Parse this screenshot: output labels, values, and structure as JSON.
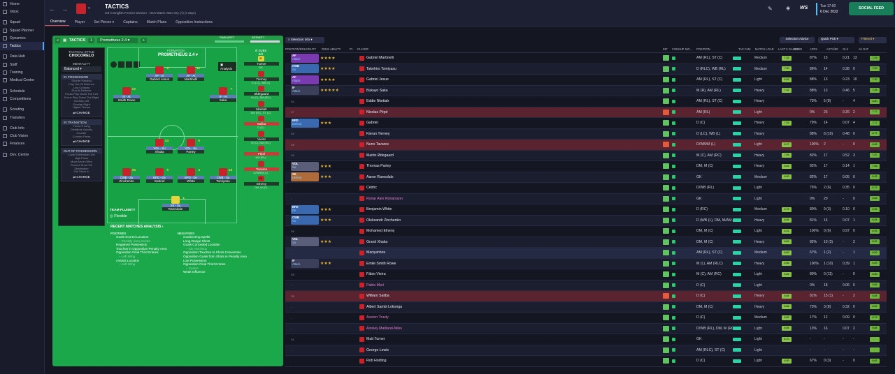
{
  "sidebar": {
    "items": [
      {
        "label": "Home",
        "icon": "home-icon"
      },
      {
        "label": "Inbox",
        "icon": "inbox-icon"
      },
      {
        "label": "Squad",
        "icon": "squad-icon"
      },
      {
        "label": "Squad Planner",
        "icon": "planner-icon"
      },
      {
        "label": "Dynamics",
        "icon": "dynamics-icon"
      },
      {
        "label": "Tactics",
        "icon": "tactics-icon"
      },
      {
        "label": "Data Hub",
        "icon": "data-hub-icon"
      },
      {
        "label": "Staff",
        "icon": "staff-icon"
      },
      {
        "label": "Training",
        "icon": "training-icon"
      },
      {
        "label": "Medical Centre",
        "icon": "medical-icon"
      },
      {
        "label": "Schedule",
        "icon": "schedule-icon"
      },
      {
        "label": "Competitions",
        "icon": "competitions-icon"
      },
      {
        "label": "Scouting",
        "icon": "scouting-icon"
      },
      {
        "label": "Transfers",
        "icon": "transfers-icon"
      },
      {
        "label": "Club Info",
        "icon": "club-info-icon"
      },
      {
        "label": "Club Vision",
        "icon": "club-vision-icon"
      },
      {
        "label": "Finances",
        "icon": "finances-icon"
      },
      {
        "label": "Dev. Centre",
        "icon": "dev-centre-icon"
      }
    ]
  },
  "header": {
    "title": "TACTICS",
    "subtitle": "3rd in English Premier Division - Next Match: Man City (A) (4 days)",
    "date_day": "Tue 17:00",
    "date": "6 Dec 2022",
    "social_feed": "SOCIAL FEED",
    "tabs": [
      "Overview",
      "Player",
      "Set Pieces ▾",
      "Captains",
      "Match Plans",
      "Opposition Instructions"
    ]
  },
  "tactics_bar": {
    "label": "TACTICS",
    "number": "1",
    "name": "Prometheus 2.4",
    "familiarity": "FAMILIARITY",
    "intensity": "INTENSITY"
  },
  "style": {
    "title": "TACTICAL STYLE",
    "name": "CHOCORELO",
    "mentality_label": "MENTALITY",
    "mentality": "Balanced",
    "in_possession": "IN POSSESSION",
    "in_possession_lines": [
      "Shorter Passing",
      "Play Out Of Defence",
      "Low Crosses",
      "Run At Defence",
      "Focus Play Down The Left",
      "Focus Play Down The Right",
      "Overlap Left",
      "Overlap Right",
      "Higher Tempo"
    ],
    "in_transition": "IN TRANSITION",
    "in_transition_lines": [
      "Throw It Long",
      "Distribute Quickly",
      "Counter",
      "Counter-Press"
    ],
    "out_of_possession": "OUT OF POSSESSION",
    "out_of_possession_lines": [
      "Lower Defensive Line",
      "High Press",
      "Much More Often",
      "Prevent Short GK",
      "Distribution",
      "Get Stuck In"
    ],
    "change": "CHANGE"
  },
  "formation": {
    "label": "FORMATION",
    "name": "PROMETHEUS 2.4",
    "analysis": "Analysis",
    "team_fluidity_label": "TEAM FLUIDITY",
    "team_fluidity": "Flexible"
  },
  "pitch_players": [
    {
      "num": "9",
      "role": "AF - At",
      "name": "Gabriel Jesus"
    },
    {
      "num": "11",
      "role": "AF - At",
      "name": "Martinelli"
    },
    {
      "num": "10",
      "role": "IF - At",
      "name": "Smith Rowe"
    },
    {
      "num": "7",
      "role": "IF - At",
      "name": "Saka"
    },
    {
      "num": "34",
      "role": "VOL - Su",
      "name": "Xhaka"
    },
    {
      "num": "5",
      "role": "VOL - Su",
      "name": "Partey"
    },
    {
      "num": "35",
      "role": "CWB - Su",
      "name": "Zinchenko"
    },
    {
      "num": "6",
      "role": "BPD - De",
      "name": "Gabriel"
    },
    {
      "num": "4",
      "role": "BPD - De",
      "name": "White"
    },
    {
      "num": "18",
      "role": "CWB - Su",
      "name": "Tomiyasu"
    },
    {
      "num": "1",
      "role": "SK - Su",
      "name": "Ramsdale"
    }
  ],
  "subs": {
    "header": "SUBS",
    "count": "9/9",
    "items": [
      {
        "num": "31",
        "name": "Turner",
        "pos": "GK"
      },
      {
        "num": "",
        "name": "Tierney",
        "pos": "D (LC), WB (L)"
      },
      {
        "num": "",
        "name": "Ødegaard",
        "pos": "M (C), AM (RC)"
      },
      {
        "num": "",
        "name": "Nketiah",
        "pos": "AM (RL), ST (C)"
      },
      {
        "num": "",
        "name": "Saliba",
        "pos": "D (C)"
      },
      {
        "num": "",
        "name": "Vieira",
        "pos": "M (C), AM (RC)"
      },
      {
        "num": "",
        "name": "Pépé",
        "pos": "AM (RL)"
      },
      {
        "num": "",
        "name": "Tavares",
        "pos": "D/WB/M (L)"
      },
      {
        "num": "23",
        "name": "Elneny",
        "pos": "DM, M (C)"
      }
    ]
  },
  "analysis": {
    "title": "RECENT MATCHES ANALYSIS",
    "positives_label": "POSITIVES",
    "positives": [
      "Goals Scored Location",
      "– Penalty Area Centre",
      "Regained Possession",
      "Touches in Opposition Penalty Area",
      "Opposition Final Third Entries",
      "– Left Wing",
      "Assists Location",
      "– Left Wing"
    ],
    "negatives_label": "NEGATIVES",
    "negatives": [
      "Goalscoring Spells",
      "Long-Range Shots",
      "Goals Conceded Location",
      "– Six Yard Box",
      "Opposition Touches to Shots Conversion",
      "Opposition Goals from Shots in Penalty Area",
      "Lost Possession",
      "Opposition Final Third Entries",
      "– Centre",
      "Weak Influence"
    ]
  },
  "table": {
    "selection_info": "Selection Info",
    "toolbar": [
      "Selection Advice",
      "Quick Pick",
      "Filtered"
    ],
    "columns": [
      "POSITION/ROLE/DUTY",
      "ROLE ABILITY",
      "PI",
      "PLAYER",
      "INF",
      "CON",
      "SHP",
      "MO...",
      "POSITION",
      "TAC FAM",
      "MATCH LOAD",
      "LAST 5 GAMES",
      "GWIN",
      "APPS",
      "ASTS/90",
      "GLS",
      "AV RAT"
    ],
    "rows": [
      {
        "pos": "STCR",
        "role": "AF",
        "duty": "Attack",
        "stars": "★★★★",
        "name": "Gabriel Martinelli",
        "position": "AM (RL), ST (C)",
        "load": "Medium",
        "rating": "7.25",
        "gwin": "87%",
        "apps": "15",
        "ast": "0.21",
        "gls": "13",
        "av": "7.29"
      },
      {
        "pos": "DR",
        "role": "CWB",
        "duty": "Su",
        "stars": "★★★★",
        "name": "Takehiro Tomiyasu",
        "position": "D (RLC), WB (RL)",
        "load": "Medium",
        "rating": "7.00",
        "gwin": "86%",
        "apps": "14",
        "ast": "0.38",
        "gls": "0",
        "av": "7.00"
      },
      {
        "pos": "STCL",
        "role": "AF",
        "duty": "Attack",
        "stars": "★★★★",
        "name": "Gabriel Jesus",
        "position": "AM (RL), ST (C)",
        "load": "Light",
        "rating": "6.83",
        "gwin": "88%",
        "apps": "13",
        "ast": "0.23",
        "gls": "10",
        "av": "7.30"
      },
      {
        "pos": "AMR",
        "role": "IF",
        "duty": "Attack",
        "stars": "★★★★★",
        "name": "Bukayo Saka",
        "position": "M (R), AM (RL)",
        "load": "Heavy",
        "rating": "7.12",
        "gwin": "88%",
        "apps": "13",
        "ast": "0.46",
        "gls": "5",
        "av": "7.26"
      },
      {
        "pos": "S4",
        "role": "",
        "duty": "",
        "stars": "",
        "name": "Eddie Nketiah",
        "position": "AM (RL), ST (C)",
        "load": "Heavy",
        "rating": "",
        "gwin": "73%",
        "apps": "5 (8)",
        "ast": "-",
        "gls": "4",
        "av": "6.80"
      },
      {
        "pos": "S7",
        "role": "",
        "duty": "",
        "stars": "",
        "name": "Nicolas Pépé",
        "position": "AM (RL)",
        "load": "Light",
        "rating": "",
        "gwin": "0%",
        "apps": "23",
        "ast": "0.26",
        "gls": "2",
        "av": "7.17",
        "red": true
      },
      {
        "pos": "DCL",
        "role": "BPD",
        "duty": "Defend",
        "stars": "★★★",
        "name": "Gabriel",
        "position": "D (C)",
        "load": "Heavy",
        "rating": "7.03",
        "gwin": "79%",
        "apps": "14",
        "ast": "0.07",
        "gls": "4",
        "av": "7.17"
      },
      {
        "pos": "S2",
        "role": "",
        "duty": "",
        "stars": "",
        "name": "Kieran Tierney",
        "position": "D (LC), WB (L)",
        "load": "Heavy",
        "rating": "",
        "gwin": "88%",
        "apps": "6 (10)",
        "ast": "0.48",
        "gls": "0",
        "av": "6.77"
      },
      {
        "pos": "S8",
        "role": "",
        "duty": "",
        "stars": "",
        "name": "Nuno Tavares",
        "position": "D/WB/M (L)",
        "load": "Light",
        "rating": "6.37",
        "gwin": "100%",
        "apps": "2",
        "ast": "-",
        "gls": "0",
        "av": "6.85",
        "red": true
      },
      {
        "pos": "S3",
        "role": "",
        "duty": "",
        "stars": "",
        "name": "Martin Ødegaard",
        "position": "M (C), AM (RC)",
        "load": "Heavy",
        "rating": "7.05",
        "gwin": "82%",
        "apps": "17",
        "ast": "0.52",
        "gls": "3",
        "av": "7.07"
      },
      {
        "pos": "DMCR",
        "role": "VOL",
        "duty": "Su",
        "stars": "★★★",
        "name": "Thomas Partey",
        "position": "DM, M (C)",
        "load": "Heavy",
        "rating": "6.83",
        "gwin": "82%",
        "apps": "17",
        "ast": "0.14",
        "gls": "1",
        "av": "7.06"
      },
      {
        "pos": "SK",
        "role": "SK",
        "duty": "Defend",
        "stars": "★★★",
        "name": "Aaron Ramsdale",
        "position": "GK",
        "load": "Medium",
        "rating": "6.90",
        "gwin": "82%",
        "apps": "17",
        "ast": "0.05",
        "gls": "0",
        "av": "6.93"
      },
      {
        "pos": "-",
        "role": "",
        "duty": "",
        "stars": "",
        "name": "Cédric",
        "position": "D/WB (RL)",
        "load": "Light",
        "rating": "",
        "gwin": "75%",
        "apps": "2 (6)",
        "ast": "0.35",
        "gls": "0",
        "av": "6.73"
      },
      {
        "pos": "-",
        "role": "",
        "duty": "",
        "stars": "",
        "name": "Rúnar Alex Rúnarsson",
        "position": "GK",
        "load": "Light",
        "rating": "",
        "gwin": "0%",
        "apps": "20",
        "ast": "-",
        "gls": "0",
        "av": "6.54",
        "pink": true
      },
      {
        "pos": "DCR",
        "role": "BPD",
        "duty": "De",
        "stars": "★★★",
        "name": "Benjamin White",
        "position": "D (RC)",
        "load": "Medium",
        "rating": "6.76",
        "gwin": "80%",
        "apps": "9 (3)",
        "ast": "0.10",
        "gls": "0",
        "av": "6.95"
      },
      {
        "pos": "DL",
        "role": "CWB",
        "duty": "Su",
        "stars": "★★★",
        "name": "Oleksandr Zinchenko",
        "position": "D (WB (L), DM, M/AM...",
        "load": "Heavy",
        "rating": "6.94",
        "gwin": "81%",
        "apps": "16",
        "ast": "0.07",
        "gls": "1",
        "av": "6.94"
      },
      {
        "pos": "S6",
        "role": "",
        "duty": "",
        "stars": "",
        "name": "Mohamed Elneny",
        "position": "DM, M (C)",
        "load": "Light",
        "rating": "6.33",
        "gwin": "100%",
        "apps": "0 (6)",
        "ast": "0.97",
        "gls": "0",
        "av": "6.93"
      },
      {
        "pos": "DMCL",
        "role": "VOL",
        "duty": "Su",
        "stars": "★★★",
        "name": "Granit Xhaka",
        "position": "DM, M (C)",
        "load": "Heavy",
        "rating": "6.89",
        "gwin": "82%",
        "apps": "10 (3)",
        "ast": "-",
        "gls": "2",
        "av": "6.91"
      },
      {
        "pos": "-",
        "role": "",
        "duty": "",
        "stars": "",
        "name": "Marquinhos",
        "position": "AM (RL), ST (C)",
        "load": "Medium",
        "rating": "6.80",
        "gwin": "67%",
        "apps": "1 (2)",
        "ast": "-",
        "gls": "1",
        "av": "6.90",
        "sel": true
      },
      {
        "pos": "AML",
        "role": "IF",
        "duty": "Attack",
        "stars": "★★★",
        "name": "Emile Smith Rowe",
        "position": "M (L), AM (RLC)",
        "load": "Heavy",
        "rating": "6.56",
        "gwin": "100%",
        "apps": "1 (10)",
        "ast": "0.39",
        "gls": "1",
        "av": "6.89"
      },
      {
        "pos": "S9",
        "role": "",
        "duty": "",
        "stars": "",
        "name": "Fábio Vieira",
        "position": "M (C), AM (RC)",
        "load": "Light",
        "rating": "6.84",
        "gwin": "80%",
        "apps": "0 (11)",
        "ast": "-",
        "gls": "0",
        "av": "6.85"
      },
      {
        "pos": "-",
        "role": "",
        "duty": "",
        "stars": "",
        "name": "Pablo Marí",
        "position": "D (C)",
        "load": "Light",
        "rating": "",
        "gwin": "0%",
        "apps": "18",
        "ast": "0.06",
        "gls": "0",
        "av": "6.66",
        "pink": true
      },
      {
        "pos": "S5",
        "role": "",
        "duty": "",
        "stars": "",
        "name": "William Saliba",
        "position": "D (C)",
        "load": "Heavy",
        "rating": "6.84",
        "gwin": "81%",
        "apps": "15 (1)",
        "ast": "-",
        "gls": "2",
        "av": "6.84",
        "red": true
      },
      {
        "pos": "-",
        "role": "",
        "duty": "",
        "stars": "",
        "name": "Albert Sambi Lokonga",
        "position": "DM, M (C)",
        "load": "Heavy",
        "rating": "6.68",
        "gwin": "73%",
        "apps": "3 (8)",
        "ast": "0.32",
        "gls": "0",
        "av": "6.81"
      },
      {
        "pos": "-",
        "role": "",
        "duty": "",
        "stars": "",
        "name": "Auston Trusty",
        "position": "D (C)",
        "load": "Medium",
        "rating": "6.62",
        "gwin": "17%",
        "apps": "12",
        "ast": "0.09",
        "gls": "0",
        "av": "6.72",
        "pink": true
      },
      {
        "pos": "-",
        "role": "",
        "duty": "",
        "stars": "",
        "name": "Ainsley Maitland-Niles",
        "position": "D/WB (RL), DM, M (RC)",
        "load": "Light",
        "rating": "6.65",
        "gwin": "13%",
        "apps": "16",
        "ast": "0.07",
        "gls": "2",
        "av": "6.68",
        "pink": true
      },
      {
        "pos": "S1",
        "role": "",
        "duty": "",
        "stars": "",
        "name": "Matt Turner",
        "position": "GK",
        "load": "Light",
        "rating": "6.70",
        "gwin": "-",
        "apps": "-",
        "ast": "-",
        "gls": "-",
        "av": "-"
      },
      {
        "pos": "-",
        "role": "",
        "duty": "",
        "stars": "",
        "name": "George Lewis",
        "position": "AM (RLC), ST (C)",
        "load": "Light",
        "rating": "",
        "gwin": "-",
        "apps": "-",
        "ast": "-",
        "gls": "-",
        "av": "-"
      },
      {
        "pos": "-",
        "role": "",
        "duty": "",
        "stars": "",
        "name": "Rob Holding",
        "position": "D (C)",
        "load": "Light",
        "rating": "6.65",
        "gwin": "67%",
        "apps": "0 (3)",
        "ast": "-",
        "gls": "0",
        "av": "6.81"
      }
    ]
  }
}
